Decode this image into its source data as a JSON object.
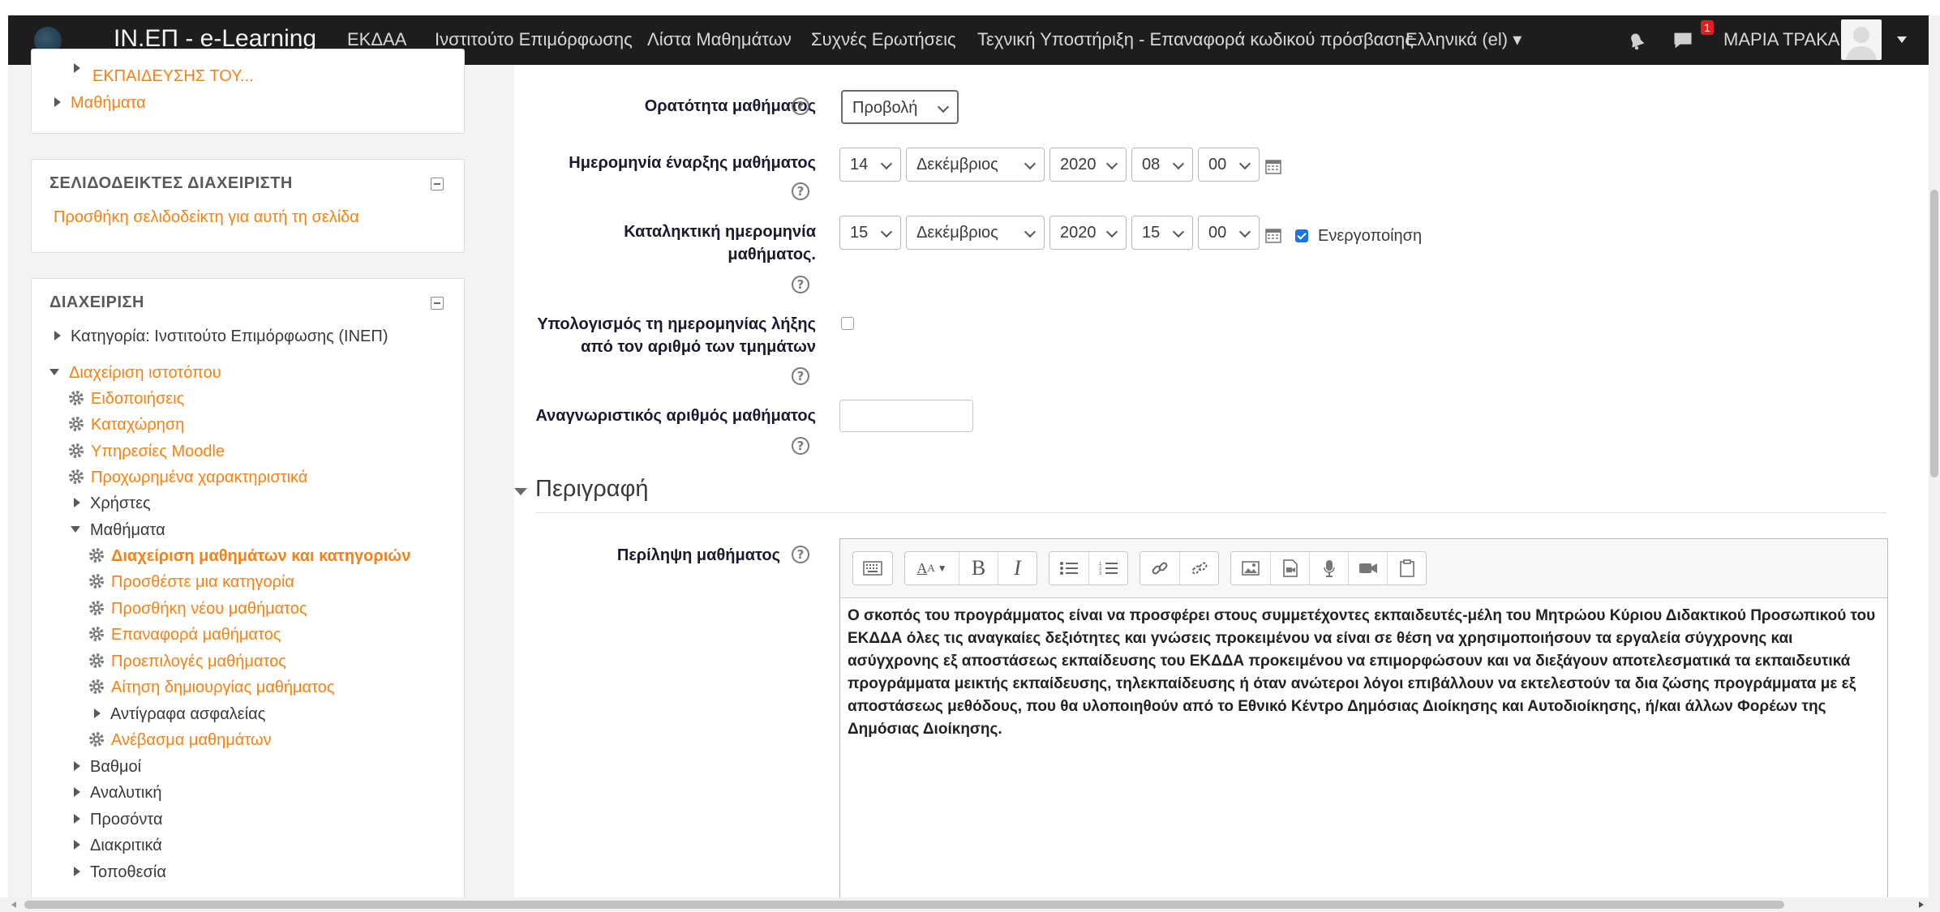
{
  "navbar": {
    "brand": "ΙΝ.ΕΠ - e-Learning",
    "links": [
      "ΕΚΔΑΑ",
      "Ινστιτούτο Επιμόρφωσης",
      "Λίστα Μαθημάτων",
      "Συχνές Ερωτήσεις",
      "Τεχνική Υποστήριξη - Επαναφορά κωδικού πρόσβασης",
      "Ελληνικά (el) ▾"
    ],
    "message_count": "1",
    "user_name": "ΜΑΡΙΑ ΤΡΑΚΑ",
    "icons": [
      "bell-icon",
      "chat-icon",
      "user-avatar",
      "caret-down-icon"
    ]
  },
  "sidebar": {
    "top_block": {
      "truncated_item": "ΕΚΠΑΙΔΕΥΣΗΣ ΤΟΥ...",
      "item": "Μαθήματα"
    },
    "bookmarks_block": {
      "title": "ΣΕΛΙΔΟΔΕΙΚΤΕΣ ΔΙΑΧΕΙΡΙΣΤΗ",
      "link": "Προσθήκη σελιδοδείκτη για αυτή τη σελίδα"
    },
    "admin_block": {
      "title": "ΔΙΑΧΕΙΡΙΣΗ",
      "category": "Κατηγορία: Ινστιτούτο Επιμόρφωσης (ΙΝΕΠ)",
      "site_admin": "Διαχείριση ιστοτόπου",
      "items": [
        "Ειδοποιήσεις",
        "Καταχώρηση",
        "Υπηρεσίες Moodle",
        "Προχωρημένα χαρακτηριστικά"
      ],
      "users": "Χρήστες",
      "courses": "Μαθήματα",
      "course_items": [
        "Διαχείριση μαθημάτων και κατηγοριών",
        "Προσθέστε μια κατηγορία",
        "Προσθήκη νέου μαθήματος",
        "Επαναφορά μαθήματος",
        "Προεπιλογές μαθήματος",
        "Αίτηση δημιουργίας μαθήματος"
      ],
      "backups": "Αντίγραφα ασφαλείας",
      "upload": "Ανέβασμα μαθημάτων",
      "more": [
        "Βαθμοί",
        "Αναλυτική",
        "Προσόντα",
        "Διακριτικά",
        "Τοποθεσία"
      ]
    }
  },
  "form": {
    "visibility": {
      "label": "Ορατότητα μαθήματος",
      "value": "Προβολή"
    },
    "start_date": {
      "label_1": "Ημερομηνία έναρξης μαθήματος",
      "day": "14",
      "month": "Δεκέμβριος",
      "year": "2020",
      "hour": "08",
      "minute": "00"
    },
    "end_date": {
      "label_1": "Καταληκτική ημερομηνία",
      "label_2": "μαθήματος.",
      "day": "15",
      "month": "Δεκέμβριος",
      "year": "2020",
      "hour": "15",
      "minute": "00",
      "enable_label": "Ενεργοποίηση",
      "enabled": true
    },
    "calc_end": {
      "label_1": "Υπολογισμός τη ημερομηνίας λήξης",
      "label_2": "από τον αριθμό των τμημάτων",
      "checked": false
    },
    "id_number": {
      "label": "Αναγνωριστικός αριθμός μαθήματος",
      "value": ""
    },
    "description_section": "Περιγραφή",
    "summary": {
      "label": "Περίληψη μαθήματος",
      "toolbar_icons": [
        "toolbar-toggle-icon",
        "font-style-icon",
        "bold-icon",
        "italic-icon",
        "bullet-list-icon",
        "numbered-list-icon",
        "link-icon",
        "unlink-icon",
        "image-icon",
        "media-icon",
        "record-audio-icon",
        "record-video-icon",
        "paste-icon"
      ],
      "text": "Ο σκοπός του προγράμματος είναι να προσφέρει στους συμμετέχοντες εκπαιδευτές-μέλη του Μητρώου Κύριου Διδακτικού Προσωπικού του ΕΚΔΔΑ όλες τις αναγκαίες δεξιότητες και γνώσεις προκειμένου να είναι σε θέση να χρησιμοποιήσουν τα εργαλεία σύγχρονης και ασύγχρονης εξ αποστάσεως εκπαίδευσης του ΕΚΔΔΑ προκειμένου να επιμορφώσουν και να διεξάγουν αποτελεσματικά τα εκπαιδευτικά προγράμματα μεικτής εκπαίδευσης, τηλεκπαίδευσης ή όταν ανώτεροι λόγοι επιβάλλουν να εκτελεστούν τα δια ζώσης προγράμματα με εξ αποστάσεως μεθόδους, που θα υλοποιηθούν από το Εθνικό Κέντρο Δημόσιας Διοίκησης και Αυτοδιοίκησης, ή/και άλλων Φορέων  της Δημόσιας Διοίκησης."
    }
  }
}
